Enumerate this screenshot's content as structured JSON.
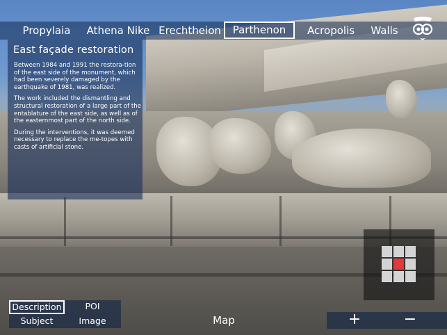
{
  "nav": {
    "items": [
      {
        "label": "Propylaia"
      },
      {
        "label": "Athena Nike"
      },
      {
        "label": "Erechtheion"
      },
      {
        "label": "Parthenon",
        "active": true
      },
      {
        "label": "Acropolis"
      },
      {
        "label": "Walls"
      }
    ],
    "menu_icon": "owl-icon"
  },
  "panel": {
    "title": "East façade restoration",
    "paragraphs": [
      "Between 1984 and 1991 the restora-tion of the east side of the monument, which had been severely damaged by the earthquake of 1981, was realized.",
      "The work included the dismantling and structural restoration of a large part of the entablature of the east side, as well as of the easternmost part of the north side.",
      "During the interventions, it was deemed necessary to replace the me-topes with casts of artificial stone."
    ]
  },
  "modes": {
    "description": "Description",
    "poi": "POI",
    "subject": "Subject",
    "image": "Image"
  },
  "map_label": "Map",
  "zoom": {
    "in": "+",
    "out": "−"
  },
  "minimap": {
    "rows": 3,
    "cols": 3,
    "selected_row": 1,
    "selected_col": 1
  },
  "colors": {
    "accent": "#e03a3a",
    "panel": "#1c325c"
  }
}
